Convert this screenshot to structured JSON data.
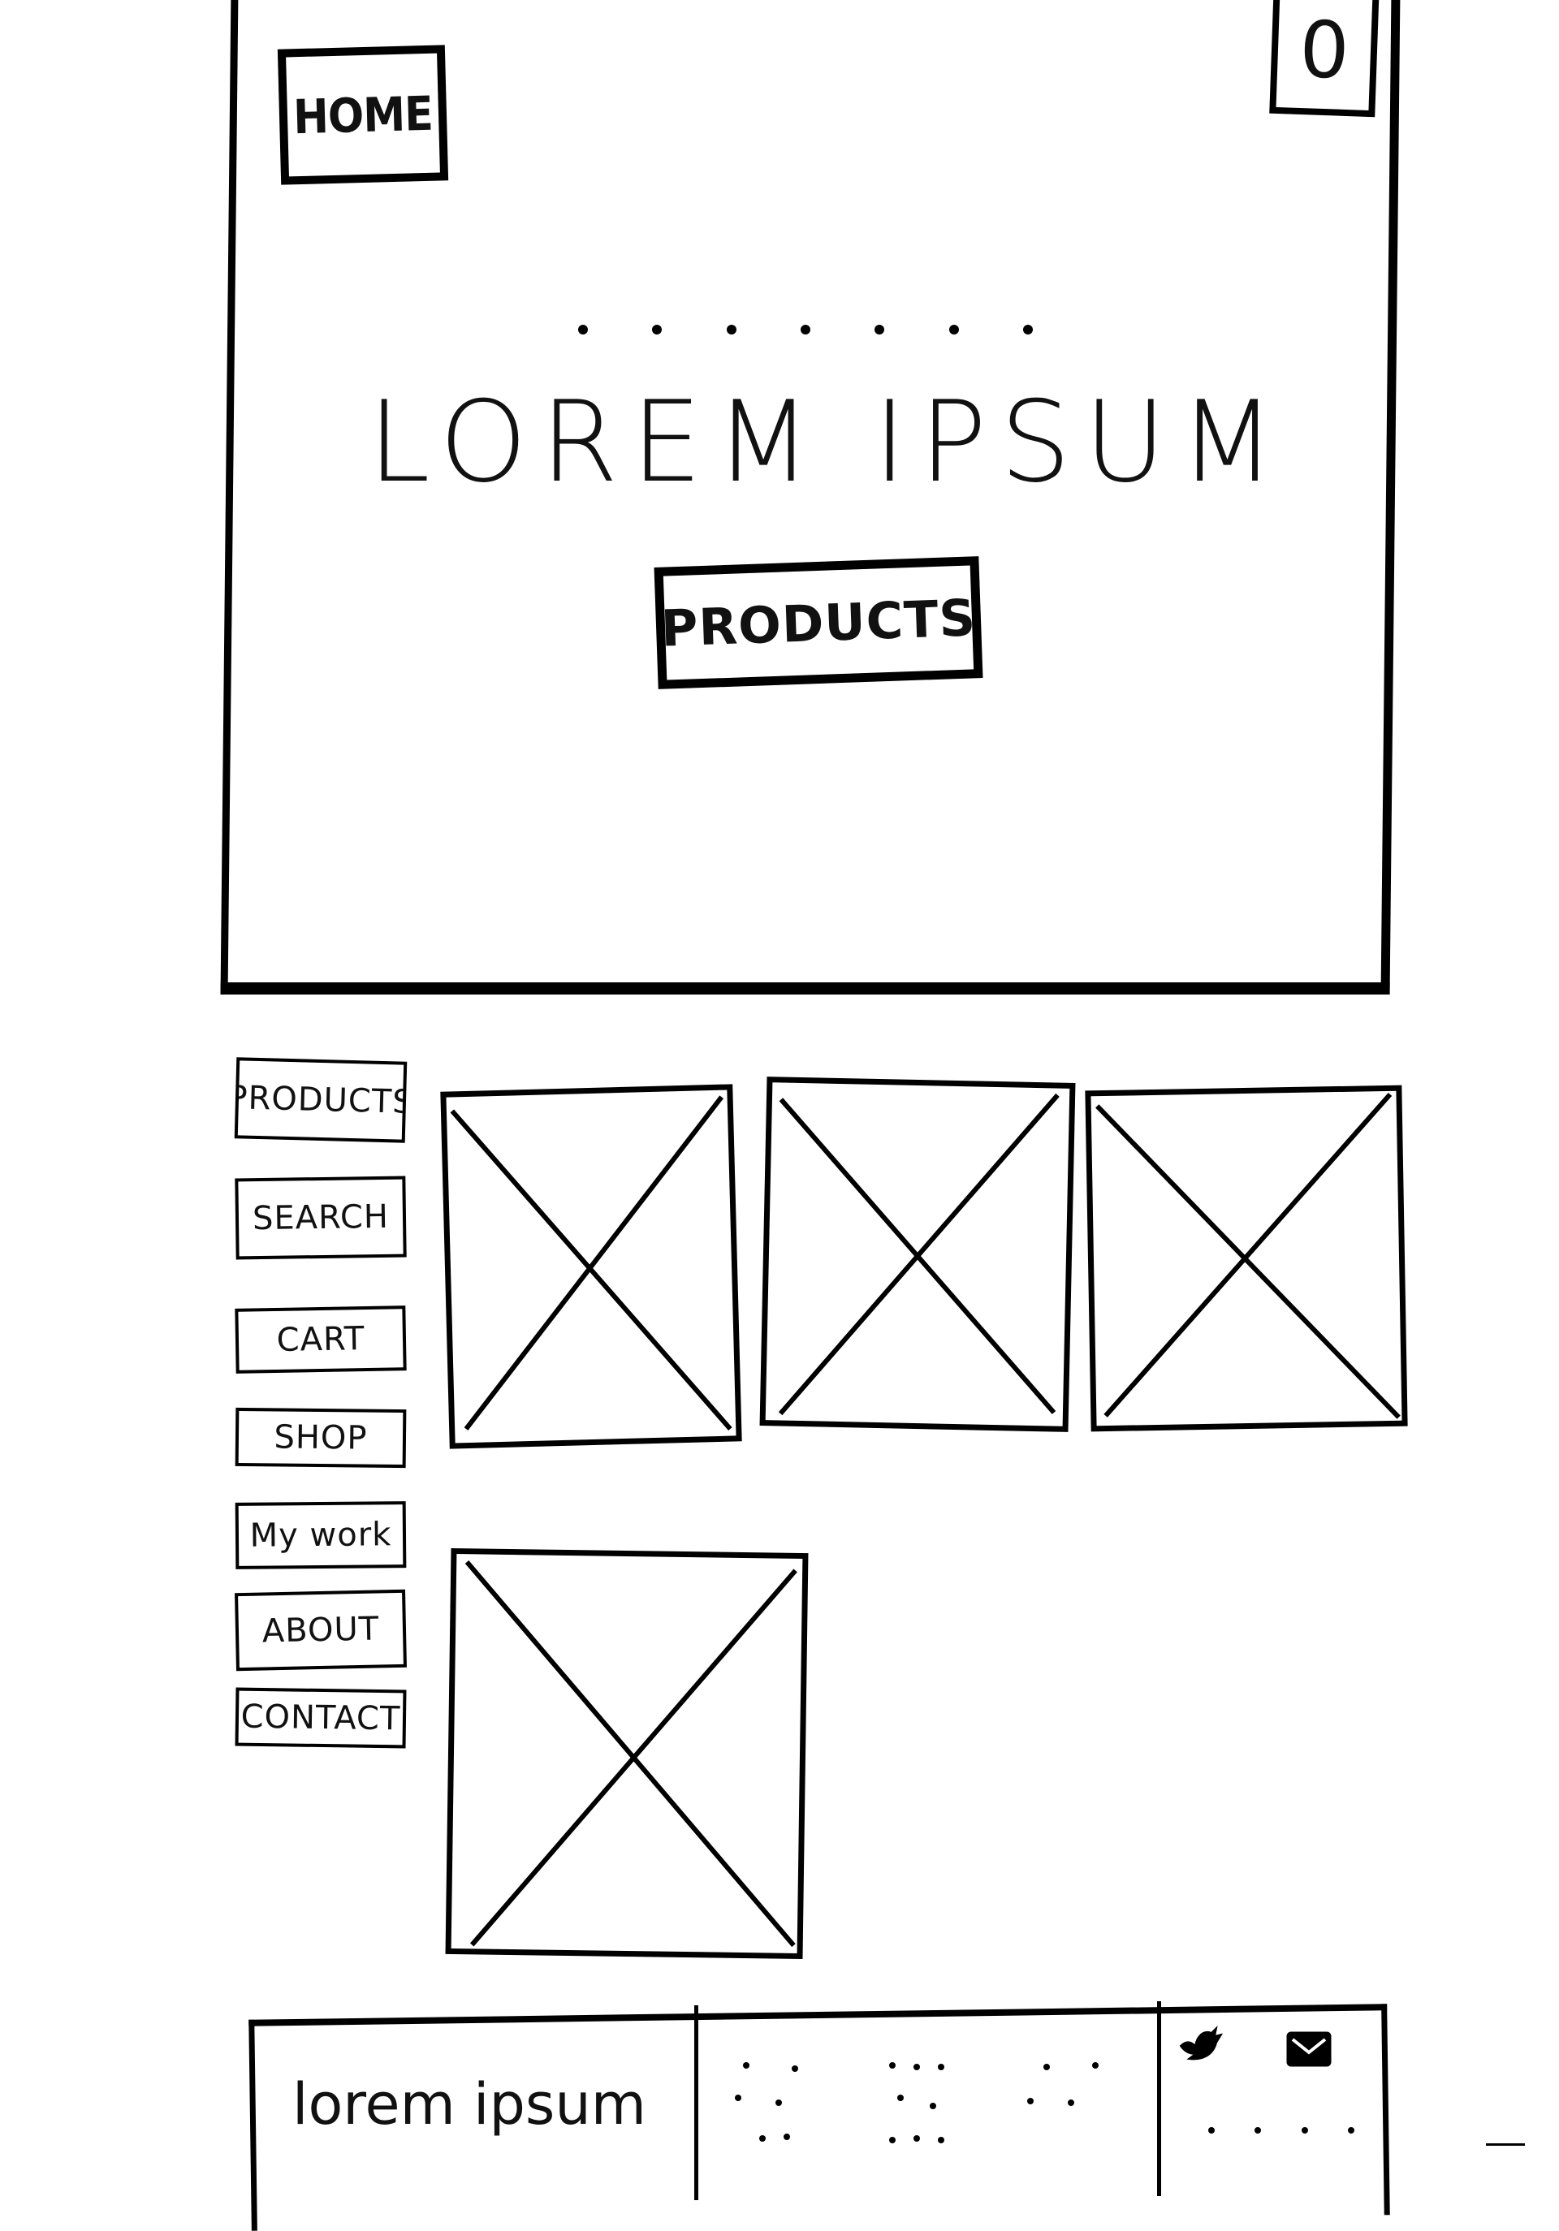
{
  "hero": {
    "home_label": "HOME",
    "corner_label": "0",
    "title": "LOREM IPSUM",
    "cta_label": "PRODUCTS"
  },
  "sidebar": {
    "items": [
      {
        "label": "PRODUCTS"
      },
      {
        "label": "SEARCH"
      },
      {
        "label": "CART"
      },
      {
        "label": "SHOP"
      },
      {
        "label": "My work"
      },
      {
        "label": "ABOUT"
      },
      {
        "label": "CONTACT"
      }
    ]
  },
  "tiles": [
    {
      "icon": "image-placeholder-icon"
    },
    {
      "icon": "image-placeholder-icon"
    },
    {
      "icon": "image-placeholder-icon"
    },
    {
      "icon": "image-placeholder-icon"
    }
  ],
  "footer": {
    "brand": "lorem ipsum",
    "social": [
      {
        "icon": "bird-icon"
      },
      {
        "icon": "message-icon"
      }
    ]
  },
  "colors": {
    "ink": "#000000",
    "paper": "#ffffff"
  }
}
